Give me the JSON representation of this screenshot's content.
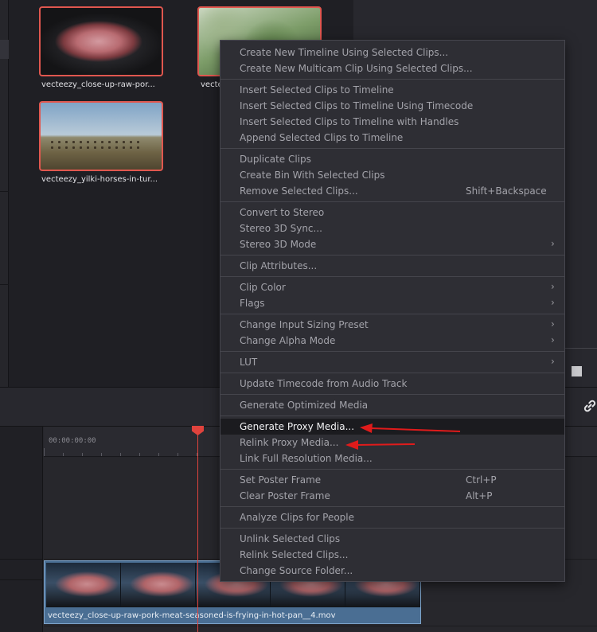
{
  "media_pool": {
    "clips": [
      {
        "name": "vecteezy_close-up-raw-por..."
      },
      {
        "name": "vecte"
      },
      {
        "name": "vecteezy_yilki-horses-in-tur..."
      }
    ]
  },
  "timeline": {
    "timecode": "00:00:00:00",
    "clip_name": "vecteezy_close-up-raw-pork-meat-seasoned-is-frying-in-hot-pan__4.mov"
  },
  "context_menu": {
    "items": [
      {
        "label": "Create New Timeline Using Selected Clips..."
      },
      {
        "label": "Create New Multicam Clip Using Selected Clips..."
      },
      {
        "label": "Insert Selected Clips to Timeline"
      },
      {
        "label": "Insert Selected Clips to Timeline Using Timecode"
      },
      {
        "label": "Insert Selected Clips to Timeline with Handles"
      },
      {
        "label": "Append Selected Clips to Timeline"
      },
      {
        "label": "Duplicate Clips"
      },
      {
        "label": "Create Bin With Selected Clips"
      },
      {
        "label": "Remove Selected Clips...",
        "shortcut": "Shift+Backspace"
      },
      {
        "label": "Convert to Stereo"
      },
      {
        "label": "Stereo 3D Sync..."
      },
      {
        "label": "Stereo 3D Mode",
        "submenu": true
      },
      {
        "label": "Clip Attributes..."
      },
      {
        "label": "Clip Color",
        "submenu": true
      },
      {
        "label": "Flags",
        "submenu": true
      },
      {
        "label": "Change Input Sizing Preset",
        "submenu": true
      },
      {
        "label": "Change Alpha Mode",
        "submenu": true
      },
      {
        "label": "LUT",
        "submenu": true
      },
      {
        "label": "Update Timecode from Audio Track"
      },
      {
        "label": "Generate Optimized Media"
      },
      {
        "label": "Generate Proxy Media...",
        "highlighted": true
      },
      {
        "label": "Relink Proxy Media..."
      },
      {
        "label": "Link Full Resolution Media..."
      },
      {
        "label": "Set Poster Frame",
        "shortcut": "Ctrl+P"
      },
      {
        "label": "Clear Poster Frame",
        "shortcut": "Alt+P"
      },
      {
        "label": "Analyze Clips for People"
      },
      {
        "label": "Unlink Selected Clips"
      },
      {
        "label": "Relink Selected Clips..."
      },
      {
        "label": "Change Source Folder..."
      }
    ],
    "submenu_icon": "chevron-right-icon"
  },
  "icons": {
    "link": "link-icon",
    "stop": "stop-square-icon",
    "more": "more-dots-icon"
  },
  "colors": {
    "selection_border": "#e0574f",
    "playhead": "#e0433d",
    "annotation_arrow": "#e01b1b",
    "clip_fill": "#4a6e93"
  }
}
